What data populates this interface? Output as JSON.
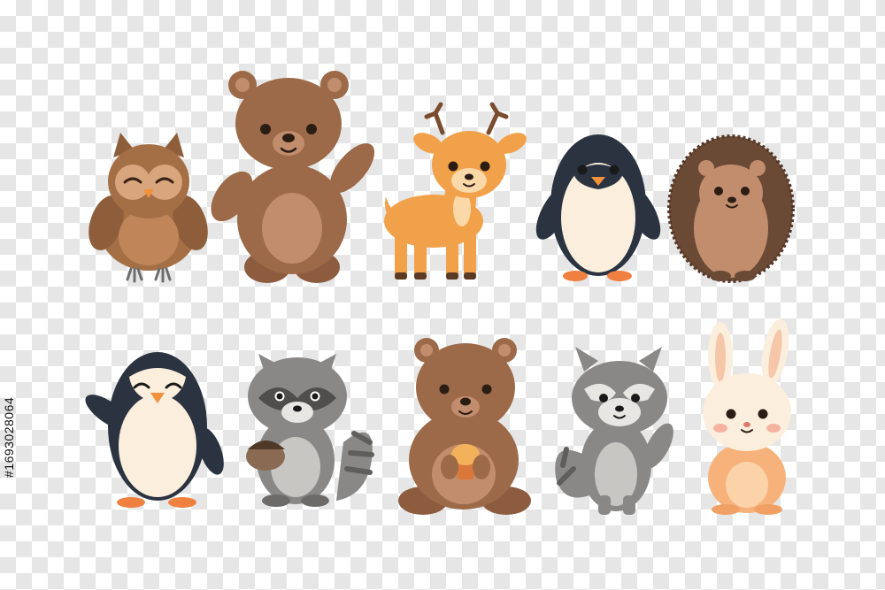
{
  "image": {
    "stock_id": "#1693028064",
    "subjects": [
      "owl",
      "bear",
      "deer",
      "penguin",
      "hedgehog",
      "penguin",
      "raccoon",
      "bear",
      "raccoon",
      "bunny"
    ]
  },
  "colors": {
    "brown": "#9c6a48",
    "brown_light": "#c28d6c",
    "owl_brown": "#a56f46",
    "deer_orange": "#f2a14b",
    "penguin_dark": "#2b3340",
    "cream": "#fbeedd",
    "gray": "#8a8886",
    "gray_light": "#c8c6c2",
    "hedgehog_spikes": "#6b4a35",
    "bunny_orange": "#f6b27a"
  }
}
